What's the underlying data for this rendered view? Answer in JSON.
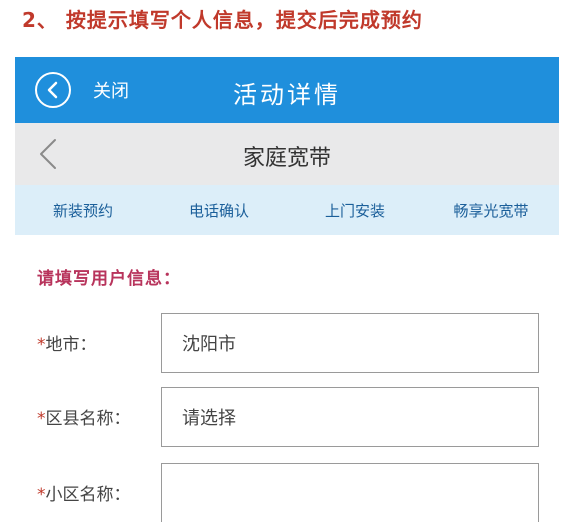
{
  "instruction": "2、 按提示填写个人信息，提交后完成预约",
  "topbar": {
    "close_label": "关闭",
    "title": "活动详情"
  },
  "navbar": {
    "title": "家庭宽带"
  },
  "steps": [
    "新装预约",
    "电话确认",
    "上门安装",
    "畅享光宽带"
  ],
  "form": {
    "title": "请填写用户信息：",
    "required_mark": "*",
    "fields": [
      {
        "label": "地市：",
        "value": "沈阳市"
      },
      {
        "label": "区县名称：",
        "value": "请选择"
      },
      {
        "label": "小区名称：",
        "value": ""
      }
    ]
  },
  "colors": {
    "topbar": "#1f8fdc",
    "navbar": "#e9e9ea",
    "steps": "#dceef9",
    "form_title": "#b8345c",
    "instruction": "#c0392b"
  }
}
